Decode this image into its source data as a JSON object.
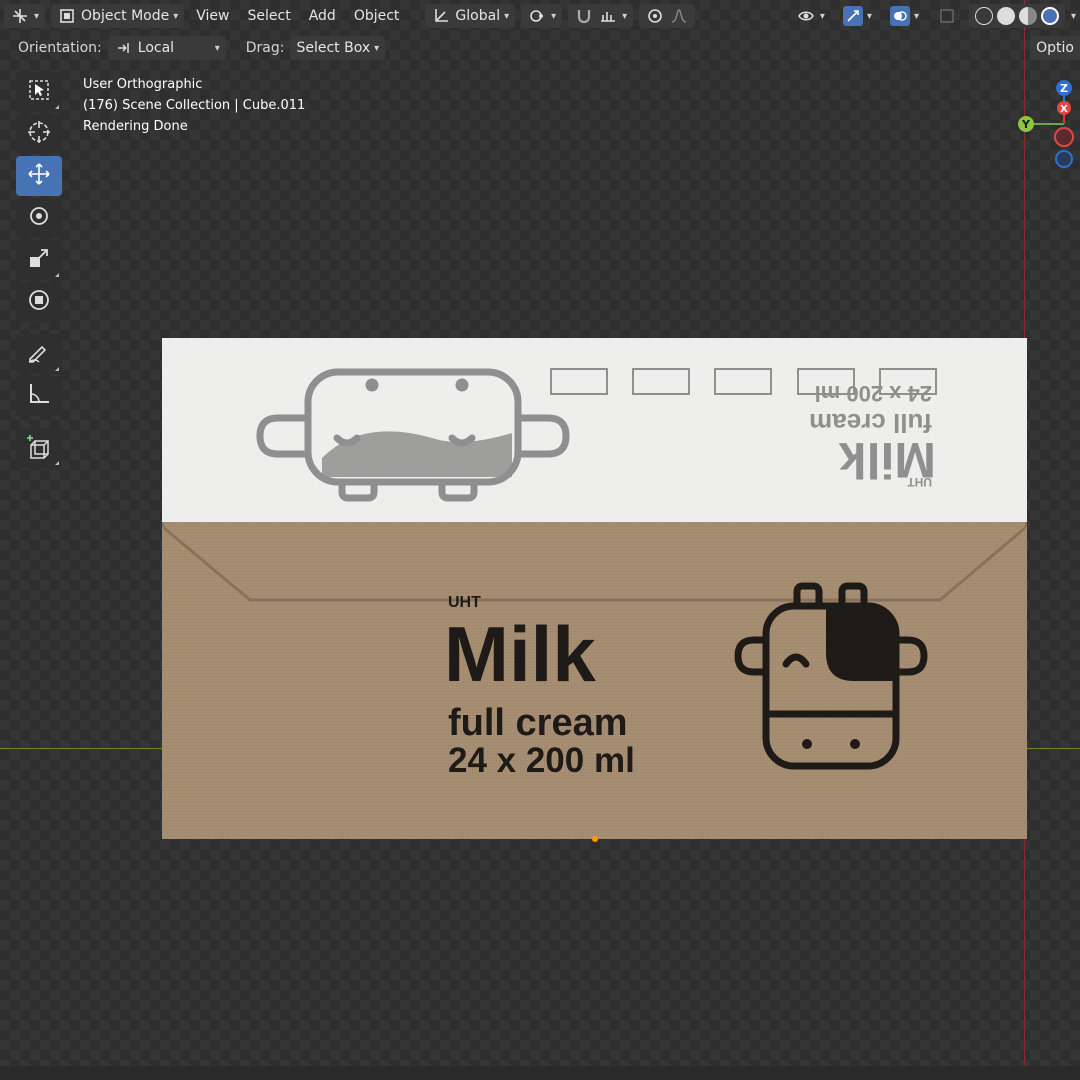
{
  "header": {
    "mode": "Object Mode",
    "menus": [
      "View",
      "Select",
      "Add",
      "Object"
    ],
    "transform_orientation": "Global",
    "options_label": "Optio"
  },
  "tool_settings": {
    "orientation_label": "Orientation:",
    "orientation_value": "Local",
    "drag_label": "Drag:",
    "drag_value": "Select Box"
  },
  "viewport_info": {
    "line1": "User Orthographic",
    "line2": "(176) Scene Collection | Cube.011",
    "line3": "Rendering Done"
  },
  "gizmo": {
    "z": "Z",
    "y": "Y",
    "x": "X"
  },
  "toolbar": {
    "tools": [
      "select-box-icon",
      "cursor-icon",
      "move-icon",
      "rotate-icon",
      "scale-icon",
      "transform-icon",
      "annotate-icon",
      "measure-icon",
      "add-cube-icon"
    ],
    "active": "move-icon"
  },
  "render": {
    "top_uht": "UHT",
    "top_brand": "Milk",
    "top_variant": "full cream",
    "top_pack": "24 x 200 ml",
    "front_uht": "UHT",
    "front_brand": "Milk",
    "front_variant": "full cream",
    "front_pack": "24 x 200 ml"
  },
  "colors": {
    "accent": "#4772b3",
    "x_axis_line": "#6a8a2a",
    "y_axis_line": "#8a2a2a",
    "carton_kraft": "#a88f73",
    "carton_top": "#eeeeec"
  }
}
